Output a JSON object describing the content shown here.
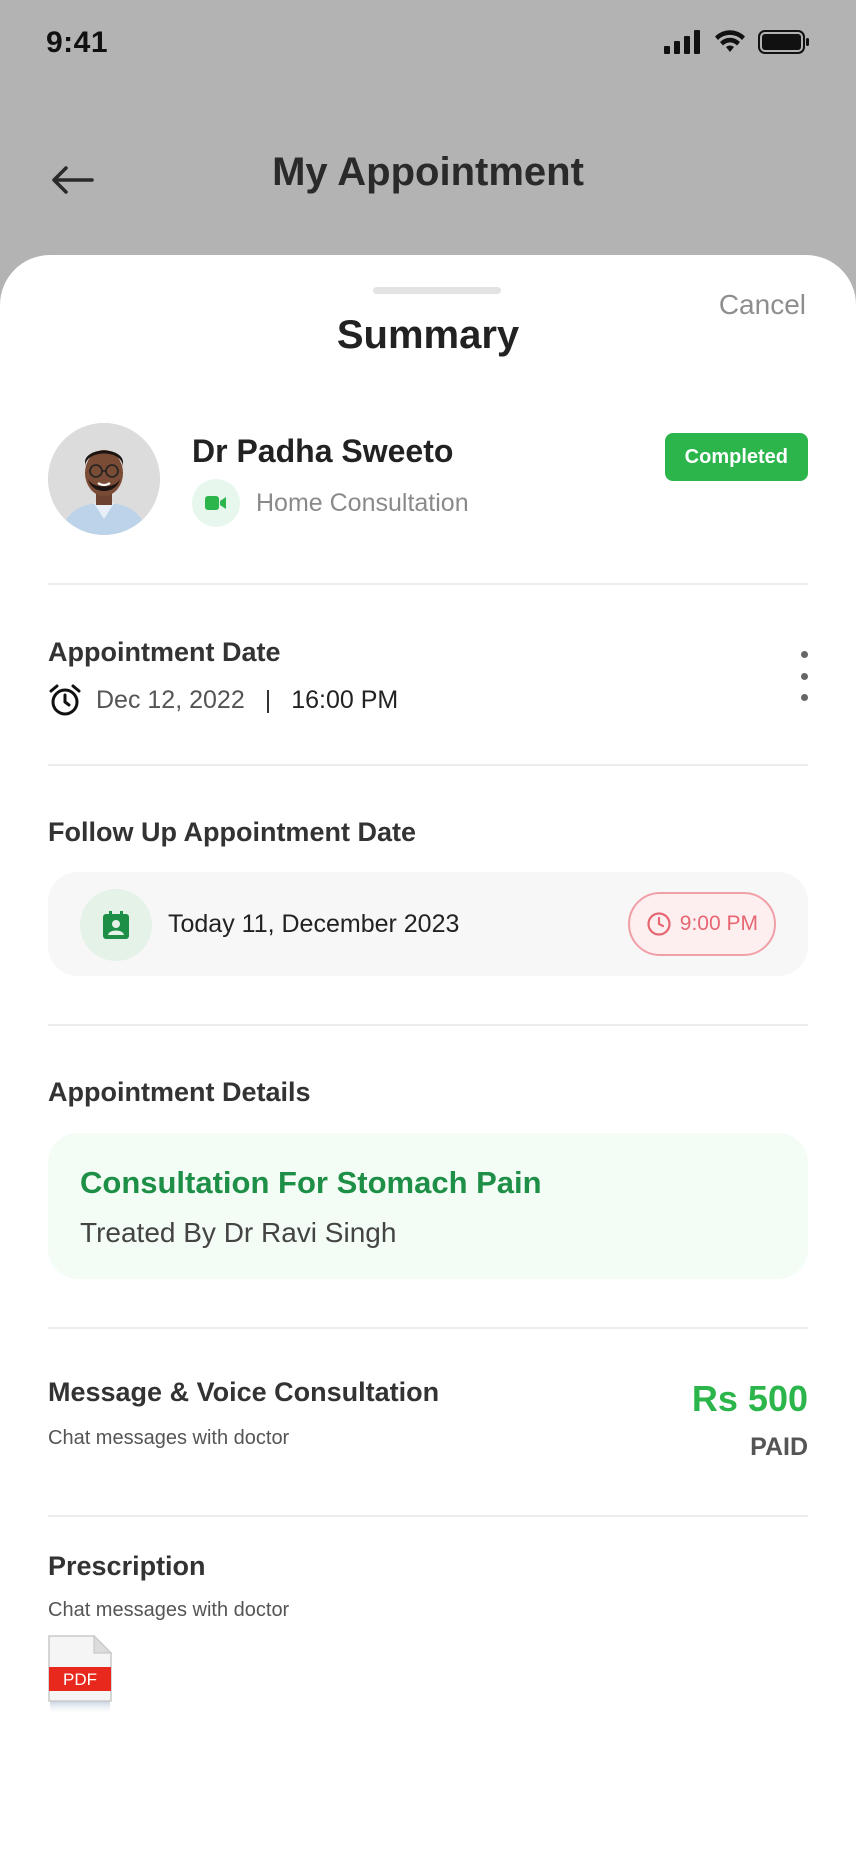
{
  "status_bar": {
    "time": "9:41"
  },
  "header": {
    "title": "My Appointment",
    "back_icon": "arrow-left-icon"
  },
  "sheet": {
    "title": "Summary",
    "cancel_label": "Cancel"
  },
  "doctor": {
    "name": "Dr Padha Sweeto",
    "consultation_type": "Home Consultation",
    "status": "Completed"
  },
  "appointment": {
    "label": "Appointment Date",
    "date": "Dec 12, 2022",
    "separator": "|",
    "time": "16:00 PM"
  },
  "follow_up": {
    "label": "Follow Up Appointment Date",
    "date": "Today 11, December 2023",
    "time": "9:00 PM"
  },
  "details": {
    "label": "Appointment Details",
    "title": "Consultation For Stomach Pain",
    "treated_by": "Treated By Dr Ravi Singh"
  },
  "payment": {
    "title": "Message & Voice Consultation",
    "subtitle": "Chat messages with doctor",
    "amount": "Rs 500",
    "status": "PAID"
  },
  "prescription": {
    "title": "Prescription",
    "subtitle": "Chat messages with doctor",
    "file_label": "PDF"
  },
  "colors": {
    "accent_green": "#2bb54b",
    "dark_green": "#1e8f46",
    "alert_red": "#e66672",
    "overlay_gray": "#b3b3b3"
  }
}
